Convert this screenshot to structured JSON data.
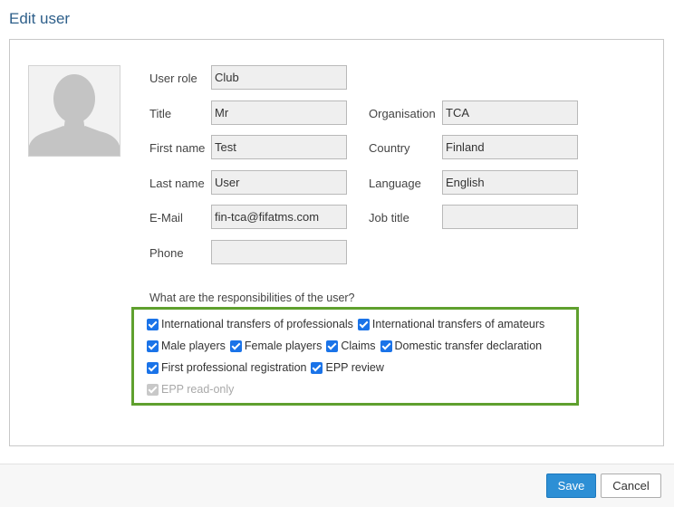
{
  "dialog": {
    "title": "Edit user"
  },
  "form": {
    "left": [
      {
        "label": "User role",
        "value": "Club"
      },
      {
        "label": "Title",
        "value": "Mr"
      },
      {
        "label": "First name",
        "value": "Test"
      },
      {
        "label": "Last name",
        "value": "User"
      },
      {
        "label": "E-Mail",
        "value": "fin-tca@fifatms.com"
      },
      {
        "label": "Phone",
        "value": ""
      }
    ],
    "right": [
      {
        "label": "Organisation",
        "value": "TCA"
      },
      {
        "label": "Country",
        "value": "Finland"
      },
      {
        "label": "Language",
        "value": "English"
      },
      {
        "label": "Job title",
        "value": ""
      }
    ]
  },
  "responsibilities": {
    "question": "What are the responsibilities of the user?",
    "options": [
      {
        "label": "International transfers of professionals",
        "checked": true,
        "disabled": false
      },
      {
        "label": "International transfers of amateurs",
        "checked": true,
        "disabled": false
      },
      {
        "label": "Male players",
        "checked": true,
        "disabled": false
      },
      {
        "label": "Female players",
        "checked": true,
        "disabled": false
      },
      {
        "label": "Claims",
        "checked": true,
        "disabled": false
      },
      {
        "label": "Domestic transfer declaration",
        "checked": true,
        "disabled": false
      },
      {
        "label": "First professional registration",
        "checked": true,
        "disabled": false
      },
      {
        "label": "EPP review",
        "checked": true,
        "disabled": false
      },
      {
        "label": "EPP read-only",
        "checked": true,
        "disabled": true
      }
    ]
  },
  "footer": {
    "save_label": "Save",
    "cancel_label": "Cancel"
  },
  "colors": {
    "title": "#2e5f8a",
    "highlight_border": "#5fa02e",
    "checkbox": "#1a73e8",
    "save_button": "#2d8fd5"
  },
  "icons": {
    "avatar": "person-silhouette-icon",
    "checkbox": "checkmark-icon"
  }
}
